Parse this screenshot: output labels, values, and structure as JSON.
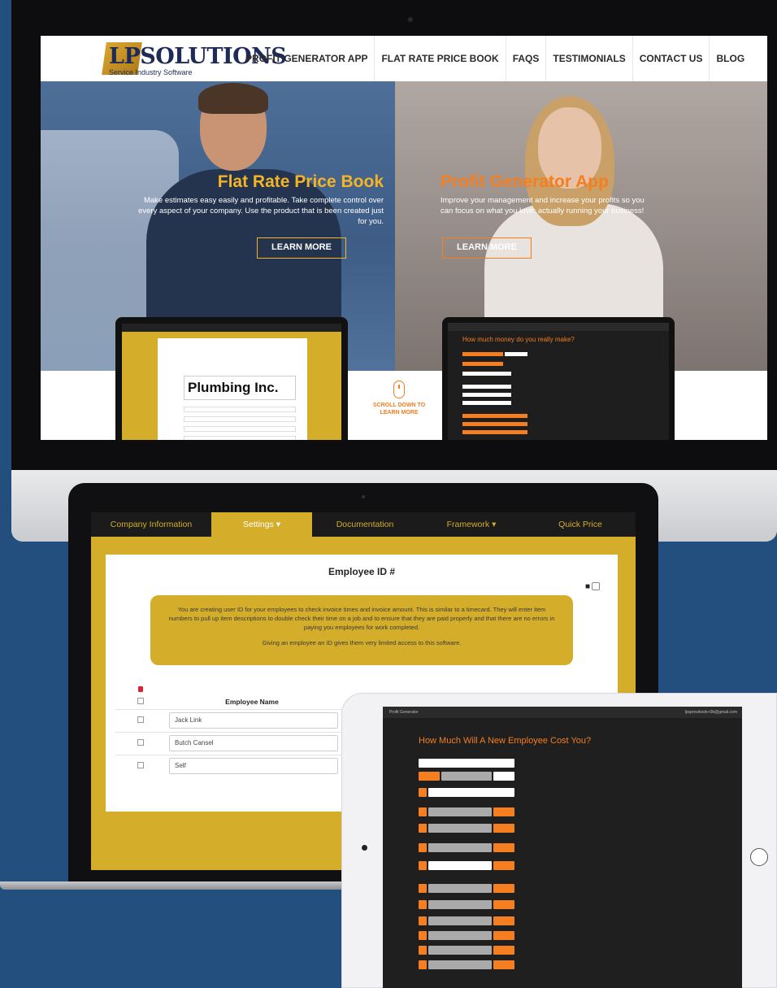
{
  "website": {
    "logo": {
      "text": "LPSOLUTIONS",
      "subtitle": "Service Industry Software"
    },
    "nav": [
      "PROFIT GENERATOR APP",
      "FLAT RATE PRICE BOOK",
      "FAQS",
      "TESTIMONIALS",
      "CONTACT US",
      "BLOG"
    ],
    "hero_left": {
      "title": "Flat Rate Price Book",
      "text": "Make estimates easy easily and profitable. Take complete control over every aspect of your company. Use the product that is been created just for you.",
      "button": "LEARN MORE",
      "preview_brand": "Plumbing Inc."
    },
    "hero_right": {
      "title": "Profit Generator App",
      "text": "Improve your management and increase your profits so you can focus on what you love: actually running your business!",
      "button": "LEARN MORE",
      "preview_heading": "How much money do you really make?"
    },
    "scroll_cta": "SCROLL DOWN TO LEARN MORE",
    "accent_colors": {
      "gold": "#f4b426",
      "orange": "#f47e20"
    }
  },
  "laptop_app": {
    "tabs": [
      "Company Information",
      "Settings",
      "Documentation",
      "Framework",
      "Quick Price"
    ],
    "active_tab": "Settings",
    "panel_title": "Employee ID #",
    "info_text": "You are creating user ID for your employees to check invoice times and invoice amount. This is similar to a timecard. They will enter item numbers to pull up item descriptions to double check their time on a job and to ensure that they are paid properly and that there are no errors in paying you employees for work completed.",
    "info_note": "Giving an employee an ID gives them very limited access to this software.",
    "column_header": "Employee Name",
    "employees": [
      "Jack Link",
      "Butch Cansel",
      "Self"
    ]
  },
  "tablet_app": {
    "header_brand": "Profit Generator",
    "header_user": "lpsprowbook+0b@gmail.com",
    "title": "How Much Will A New Employee Cost You?"
  }
}
